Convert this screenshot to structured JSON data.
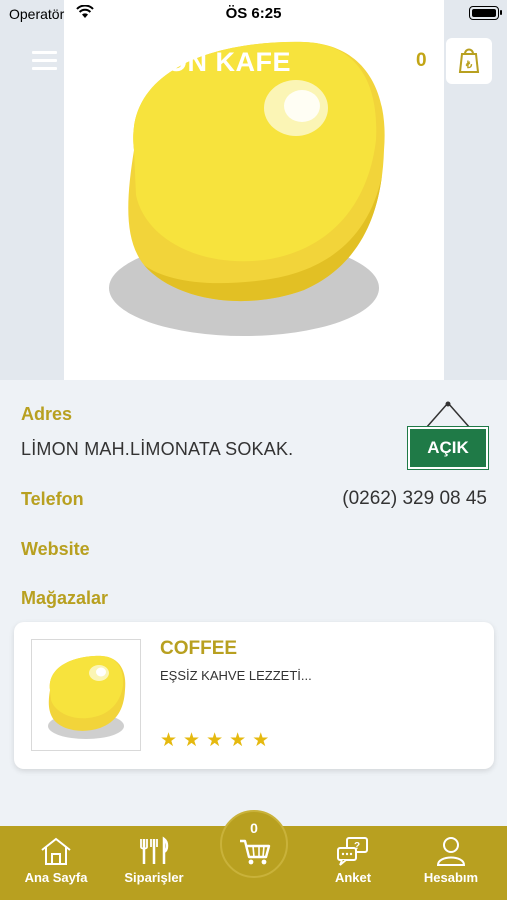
{
  "status_bar": {
    "carrier": "Operatör",
    "time": "ÖS 6:25"
  },
  "header": {
    "title": "LİMON KAFE",
    "cart_count": "0"
  },
  "info": {
    "address_label": "Adres",
    "address_value": "LİMON MAH.LİMONATA SOKAK.",
    "open_status": "AÇIK",
    "phone_label": "Telefon",
    "phone_value": "(0262) 329 08 45",
    "website_label": "Website",
    "stores_label": "Mağazalar"
  },
  "stores": [
    {
      "name": "COFFEE",
      "description": "EŞSİZ KAHVE LEZZETİ...",
      "rating": 5
    }
  ],
  "colors": {
    "brand": "#b8a020",
    "open_green": "#1f7a47",
    "star": "#e5b90f"
  },
  "tab_bar": {
    "items": [
      {
        "label": "Ana Sayfa",
        "icon": "home-icon"
      },
      {
        "label": "Siparişler",
        "icon": "cutlery-icon"
      },
      {
        "label": "Anket",
        "icon": "survey-chat-icon"
      },
      {
        "label": "Hesabım",
        "icon": "user-icon"
      }
    ],
    "cart_count": "0",
    "cart_icon": "cart-icon"
  }
}
